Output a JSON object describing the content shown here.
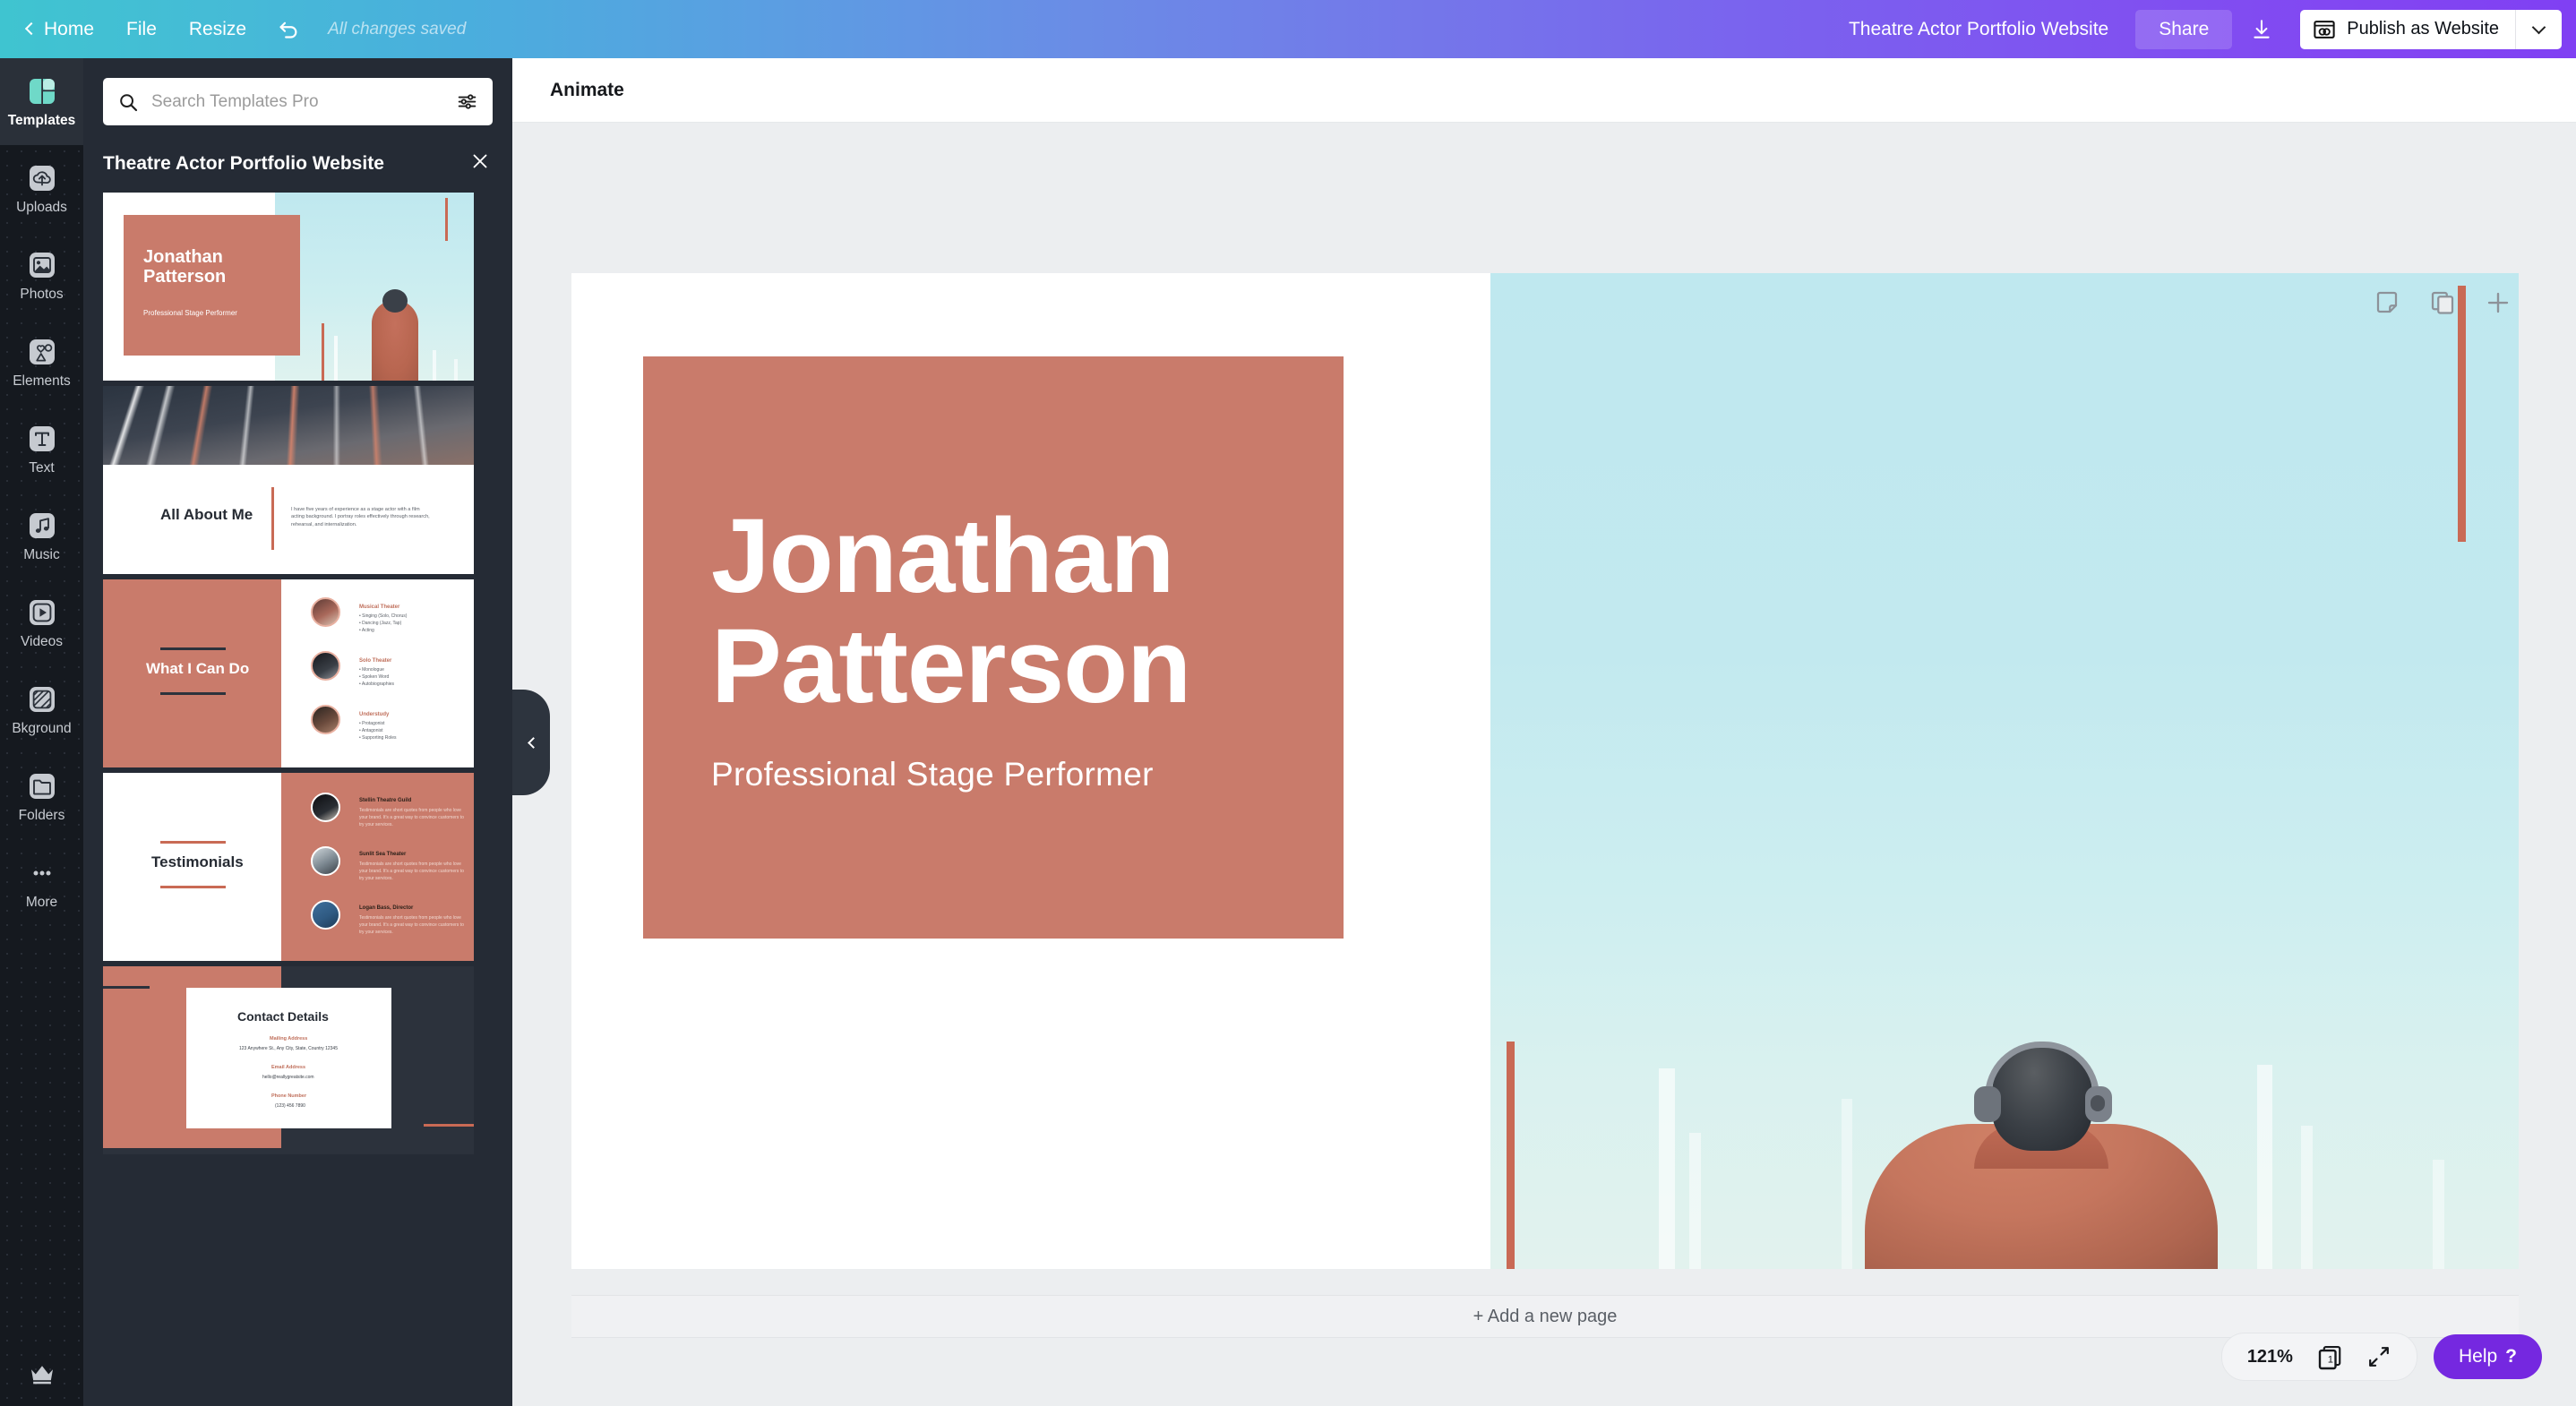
{
  "topbar": {
    "home_label": "Home",
    "file_label": "File",
    "resize_label": "Resize",
    "undo_icon": "undo-icon",
    "saved_status": "All changes saved",
    "doc_title": "Theatre Actor Portfolio Website",
    "share_label": "Share",
    "download_icon": "download-icon",
    "publish_label": "Publish as Website",
    "publish_icon": "browser-window-icon",
    "publish_caret_icon": "chevron-down-icon",
    "gradient_start": "#3fc4d0",
    "gradient_end": "#8040f3"
  },
  "rail": {
    "items": [
      {
        "label": "Templates",
        "icon": "templates-icon",
        "active": true
      },
      {
        "label": "Uploads",
        "icon": "cloud-upload-icon",
        "active": false
      },
      {
        "label": "Photos",
        "icon": "photo-icon",
        "active": false
      },
      {
        "label": "Elements",
        "icon": "shapes-icon",
        "active": false
      },
      {
        "label": "Text",
        "icon": "text-t-icon",
        "active": false
      },
      {
        "label": "Music",
        "icon": "music-note-icon",
        "active": false
      },
      {
        "label": "Videos",
        "icon": "video-play-icon",
        "active": false
      },
      {
        "label": "Bkground",
        "icon": "hatch-pattern-icon",
        "active": false
      },
      {
        "label": "Folders",
        "icon": "folder-icon",
        "active": false
      },
      {
        "label": "More",
        "icon": "ellipsis-icon",
        "active": false
      }
    ],
    "crown_icon": "crown-icon",
    "active_accent": "#6fd9c8"
  },
  "panel": {
    "search_placeholder": "Search Templates Pro",
    "search_value": "",
    "search_icon": "search-icon",
    "filter_icon": "sliders-filter-icon",
    "title": "Theatre Actor Portfolio Website",
    "close_icon": "close-x-icon",
    "collapse_icon": "chevron-left-icon",
    "templates": [
      {
        "name": "title-slide",
        "heading_line1": "Jonathan",
        "heading_line2": "Patterson",
        "subheading": "Professional Stage Performer"
      },
      {
        "name": "about-slide",
        "heading": "All About Me",
        "body": "I have five years of experience as a stage actor with a film acting background. I portray roles effectively through research, rehearsal, and internalization."
      },
      {
        "name": "skills-slide",
        "heading": "What I Can Do",
        "entries": [
          {
            "title": "Musical Theater",
            "bullets": [
              "Singing (Solo, Chorus)",
              "Dancing (Jazz, Tap)",
              "Acting"
            ]
          },
          {
            "title": "Solo Theater",
            "bullets": [
              "Monologue",
              "Spoken Word",
              "Autobiographies"
            ]
          },
          {
            "title": "Understudy",
            "bullets": [
              "Protagonist",
              "Antagonist",
              "Supporting Roles"
            ]
          }
        ]
      },
      {
        "name": "testimonials-slide",
        "heading": "Testimonials",
        "entries": [
          {
            "title": "Stellin Theatre Guild",
            "body": "Testimonials are short quotes from people who love your brand. It's a great way to convince customers to try your services."
          },
          {
            "title": "Sunlit Sea Theater",
            "body": "Testimonials are short quotes from people who love your brand. It's a great way to convince customers to try your services."
          },
          {
            "title": "Logan Bass, Director",
            "body": "Testimonials are short quotes from people who love your brand. It's a great way to convince customers to try your services."
          }
        ]
      },
      {
        "name": "contact-slide",
        "heading": "Contact Details",
        "fields": [
          {
            "label": "Mailing Address",
            "value": "123 Anywhere St., Any City, State, Country 12345"
          },
          {
            "label": "Email Address",
            "value": "hello@reallygreatsite.com"
          },
          {
            "label": "Phone Number",
            "value": "(123) 456 7890"
          }
        ]
      }
    ]
  },
  "editor": {
    "animate_label": "Animate",
    "page_note_icon": "page-note-icon",
    "page_duplicate_icon": "duplicate-page-icon",
    "page_add_icon": "plus-icon",
    "add_page_label": "+ Add a new page",
    "canvas": {
      "name_line1": "Jonathan",
      "name_line2": "Patterson",
      "role": "Professional Stage Performer",
      "coral_color": "#c97b6b",
      "accent_line_color": "#c96a55",
      "sky_color": "#bfe8ef"
    }
  },
  "status": {
    "zoom_level": "121%",
    "page_count_icon": "pages-stack-icon",
    "page_number": "1",
    "fullscreen_icon": "expand-arrows-icon",
    "help_label": "Help",
    "help_mark": "?",
    "help_color": "#7528e0"
  }
}
